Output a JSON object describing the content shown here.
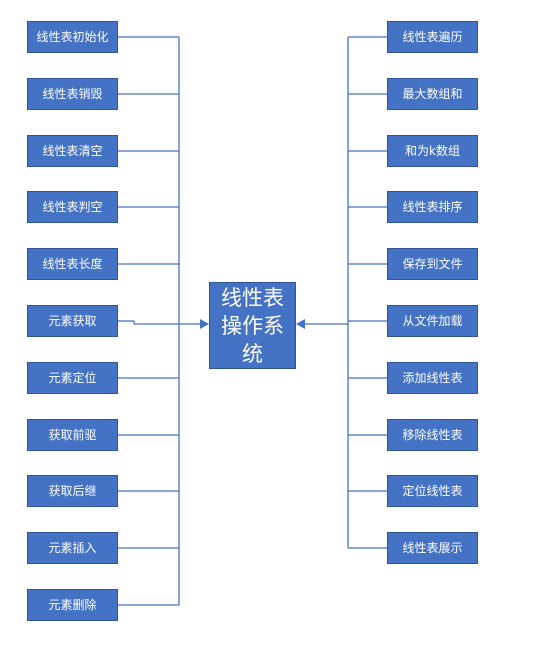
{
  "center": {
    "label": "线性表操作系统"
  },
  "left_items": [
    "线性表初始化",
    "线性表销毁",
    "线性表清空",
    "线性表判空",
    "线性表长度",
    "元素获取",
    "元素定位",
    "获取前驱",
    "获取后继",
    "元素插入",
    "元素删除"
  ],
  "right_items": [
    "线性表遍历",
    "最大数组和",
    "和为k数组",
    "线性表排序",
    "保存到文件",
    "从文件加载",
    "添加线性表",
    "移除线性表",
    "定位线性表",
    "线性表展示"
  ],
  "colors": {
    "box_fill": "#4472c4",
    "box_border": "#2f5597",
    "line": "#4472c4",
    "text": "#ffffff"
  }
}
